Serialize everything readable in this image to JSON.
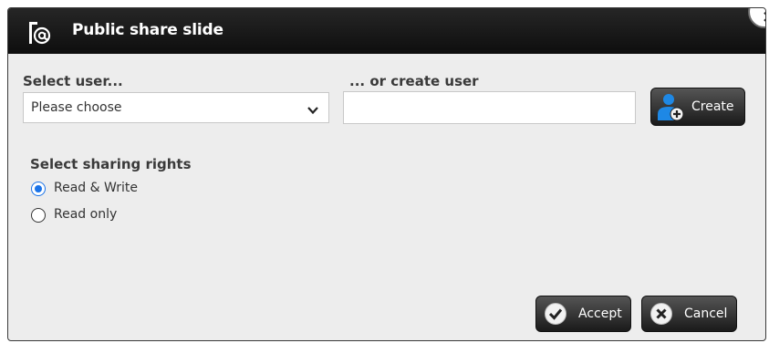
{
  "dialog": {
    "title": "Public share slide",
    "close_symbol": "×"
  },
  "select_user": {
    "label": "Select user...",
    "value": "Please choose"
  },
  "create_user": {
    "label": "... or create user",
    "value": "",
    "button_label": "Create"
  },
  "sharing": {
    "label": "Select sharing rights",
    "options": [
      {
        "label": "Read & Write",
        "checked": true
      },
      {
        "label": "Read only",
        "checked": false
      }
    ]
  },
  "footer": {
    "accept_label": "Accept",
    "cancel_label": "Cancel"
  },
  "colors": {
    "titlebar": "#111111",
    "panel": "#ededed",
    "radio_accent": "#1a73e8",
    "create_icon_blue": "#1e88e5"
  },
  "icons": [
    "share-link-icon",
    "close-icon",
    "chevron-down-icon",
    "add-user-icon",
    "checkmark-icon",
    "cancel-x-icon"
  ]
}
